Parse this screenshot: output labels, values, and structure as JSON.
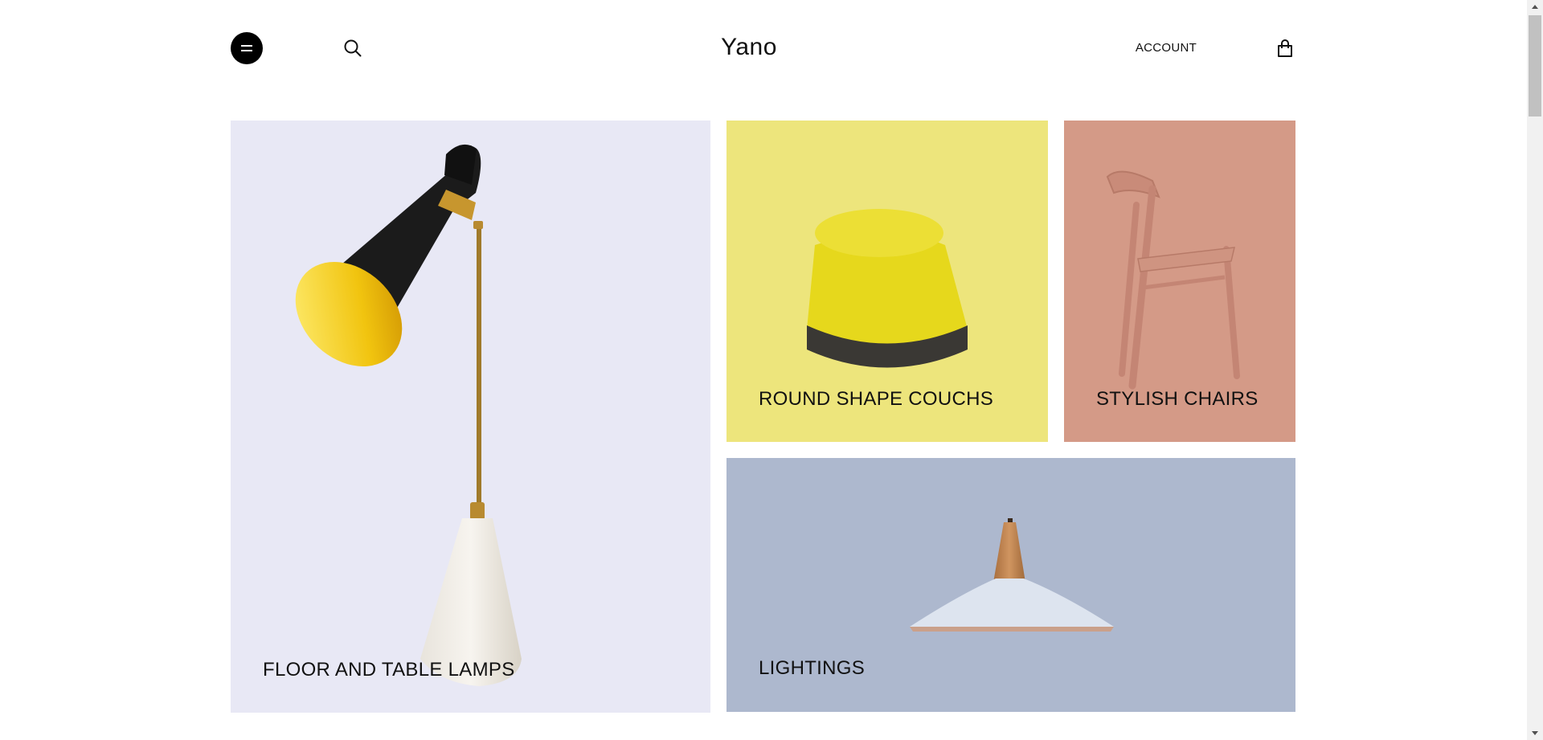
{
  "header": {
    "logo": "Yano",
    "account_label": "ACCOUNT",
    "menu_icon": "menu-icon",
    "search_icon": "search-icon",
    "cart_icon": "shopping-bag-icon"
  },
  "categories": [
    {
      "label": "FLOOR AND TABLE LAMPS",
      "bg": "#e8e8f5",
      "image": "table-lamp-image"
    },
    {
      "label": "ROUND SHAPE COUCHS",
      "bg": "#ede57c",
      "image": "round-pouf-image"
    },
    {
      "label": "STYLISH CHAIRS",
      "bg": "#d49a87",
      "image": "wooden-chair-image"
    },
    {
      "label": "LIGHTINGS",
      "bg": "#adb8ce",
      "image": "pendant-lamp-image"
    }
  ],
  "colors": {
    "accent": "#000000",
    "background": "#ffffff"
  }
}
